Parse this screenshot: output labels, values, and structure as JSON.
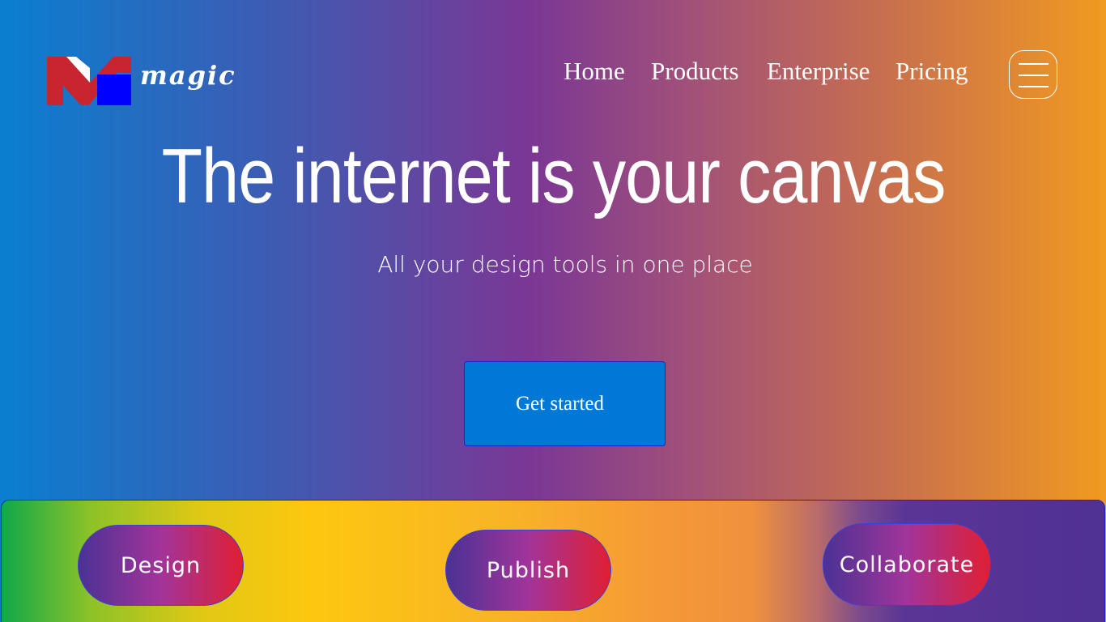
{
  "brand": {
    "name": "magic",
    "colors": {
      "red": "#c8252f",
      "blue": "#0000ff"
    }
  },
  "nav": {
    "items": [
      {
        "label": "Home"
      },
      {
        "label": "Products"
      },
      {
        "label": "Enterprise"
      },
      {
        "label": "Pricing"
      }
    ],
    "menu_icon": "hamburger-menu-icon"
  },
  "hero": {
    "title": "The internet is your canvas",
    "subtitle": "All your design tools in one place",
    "cta_label": "Get started"
  },
  "features": {
    "items": [
      {
        "label": "Design"
      },
      {
        "label": "Publish"
      },
      {
        "label": "Collaborate"
      }
    ]
  },
  "colors": {
    "cta_background": "#0079d6",
    "pill_gradient": [
      "#4b3294",
      "#a2349a",
      "#e01f33"
    ]
  }
}
